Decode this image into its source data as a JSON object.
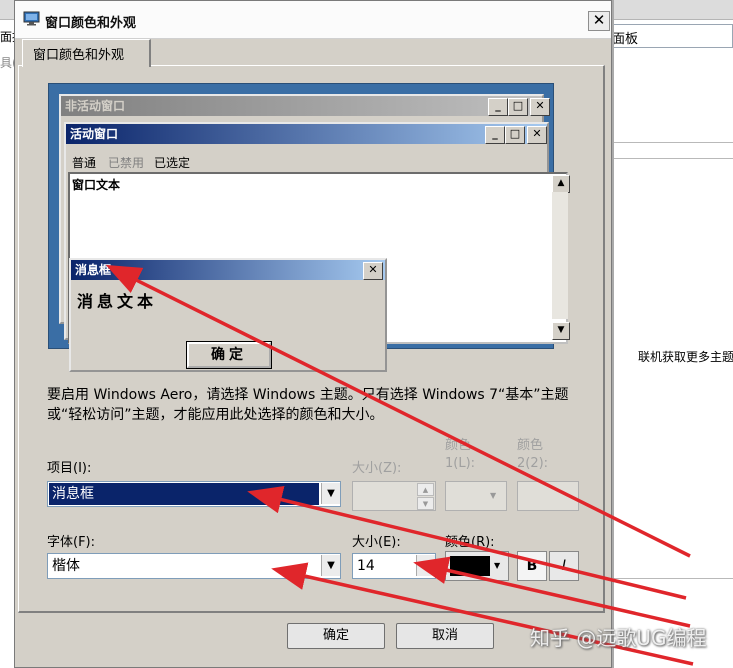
{
  "background": {
    "left_text_1": "面控",
    "left_text_2": "具(",
    "address_text": "面板",
    "link_text": "联机获取更多主题"
  },
  "dialog": {
    "title": "窗口颜色和外观",
    "close_glyph": "✕",
    "tab_label": "窗口颜色和外观"
  },
  "preview": {
    "inactive_title": "非活动窗口",
    "active_title": "活动窗口",
    "menu_normal": "普通",
    "menu_disabled": "已禁用",
    "menu_selected": "已选定",
    "window_text": "窗口文本",
    "message_title": "消息框",
    "message_text": "消息文本",
    "ok_label": "确定",
    "minimize_glyph": "_",
    "maximize_glyph": "□",
    "close_glyph": "✕"
  },
  "aero_notice": "要启用 Windows Aero，请选择 Windows 主题。只有选择 Windows 7“基本”主题或“轻松访问”主题，才能应用此处选择的颜色和大小。",
  "form": {
    "item_label": "项目(I):",
    "item_value": "消息框",
    "size_z_label": "大小(Z):",
    "color1_label": "颜色 1(L):",
    "color2_label": "颜色 2(2):",
    "font_label": "字体(F):",
    "font_value": "楷体",
    "size_e_label": "大小(E):",
    "size_e_value": "14",
    "color_r_label": "颜色(R):",
    "bold_label": "B",
    "italic_label": "I"
  },
  "buttons": {
    "ok": "确定",
    "cancel": "取消"
  },
  "watermark": "知乎 @远歌UG编程",
  "colors": {
    "preview_bg": "#3a6ea5",
    "active_title_start": "#0a246a",
    "arrow": "#e0262b",
    "font_color": "#000000"
  }
}
